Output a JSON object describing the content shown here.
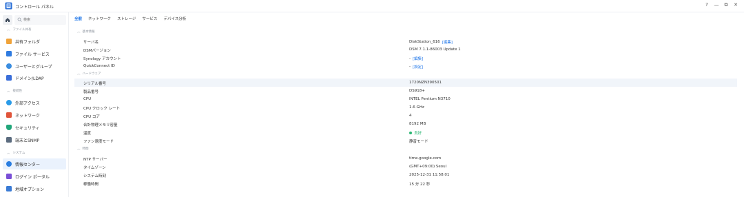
{
  "window": {
    "title": "コントロール パネル",
    "controls": [
      "?",
      "—",
      "⧉",
      "✕"
    ]
  },
  "search": {
    "placeholder": "検索"
  },
  "sidebar": {
    "sections": [
      {
        "label": "ファイル共有",
        "items": [
          {
            "label": "共有フォルダ",
            "icon": "folder-share-icon",
            "color": "#f0a33a"
          },
          {
            "label": "ファイル サービス",
            "icon": "file-services-icon",
            "color": "#2f7be0"
          },
          {
            "label": "ユーザーとグループ",
            "icon": "users-groups-icon",
            "color": "#3a8de0"
          },
          {
            "label": "ドメイン/LDAP",
            "icon": "domain-ldap-icon",
            "color": "#3a6ed9"
          }
        ]
      },
      {
        "label": "接続性",
        "items": [
          {
            "label": "外部アクセス",
            "icon": "external-access-icon",
            "color": "#2a9be8"
          },
          {
            "label": "ネットワーク",
            "icon": "network-icon",
            "color": "#e0543a"
          },
          {
            "label": "セキュリティ",
            "icon": "security-icon",
            "color": "#21a67a"
          },
          {
            "label": "端末とSNMP",
            "icon": "terminal-snmp-icon",
            "color": "#5b6b7e"
          }
        ]
      },
      {
        "label": "システム",
        "items": [
          {
            "label": "情報センター",
            "icon": "info-center-icon",
            "color": "#2b7ee0",
            "active": true
          },
          {
            "label": "ログイン ポータル",
            "icon": "login-portal-icon",
            "color": "#7a4fd6"
          },
          {
            "label": "地域オプション",
            "icon": "regional-options-icon",
            "color": "#3a7bd5"
          }
        ]
      }
    ]
  },
  "tabs": [
    "全般",
    "ネットワーク",
    "ストレージ",
    "サービス",
    "デバイス分析"
  ],
  "groups": {
    "basic": {
      "label": "基本情報",
      "rows": [
        {
          "label": "サーバ名",
          "value": "DiskStation_616",
          "link": "[編集]"
        },
        {
          "label": "DSMバージョン",
          "value": "DSM 7.1.1-86003 Update 1"
        },
        {
          "label": "Synology アカウント",
          "value": "-",
          "link": "[編集]"
        },
        {
          "label": "QuickConnect ID",
          "value": "-",
          "link": "[設定]"
        }
      ]
    },
    "hardware": {
      "label": "ハードウェア",
      "rows": [
        {
          "label": "シリアル番号",
          "value": "1720NZN390501"
        },
        {
          "label": "製品番号",
          "value": "DS918+"
        },
        {
          "label": "CPU",
          "value": "INTEL Pentium N3710"
        },
        {
          "label": "CPU クロック レート",
          "value": "1.6 GHz"
        },
        {
          "label": "CPU コア",
          "value": "4"
        },
        {
          "label": "合計物理メモリ容量",
          "value": "8192 MB"
        },
        {
          "label": "温度",
          "value": "良好",
          "status_color": "#2bb673"
        },
        {
          "label": "ファン速度モード",
          "value": "静音モード"
        }
      ]
    },
    "time": {
      "label": "時間",
      "rows": [
        {
          "label": "NTP サーバー",
          "value": "time.google.com"
        },
        {
          "label": "タイムゾーン",
          "value": "(GMT+09:00) Seoul"
        },
        {
          "label": "システム時刻",
          "value": "2025-12-31 11:58:01"
        },
        {
          "label": "稼働時間",
          "value": "15 分 22 秒"
        }
      ]
    }
  },
  "colors": {
    "accent": "#1a73e8",
    "active_bg": "#eaf2fd",
    "row_highlight": "#f1f5fa"
  }
}
